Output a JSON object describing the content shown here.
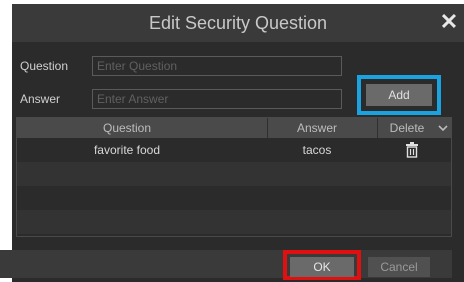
{
  "dialog": {
    "title": "Edit Security Question",
    "close_icon": "close-icon"
  },
  "form": {
    "question_label": "Question",
    "question_value": "",
    "question_placeholder": "Enter Question",
    "answer_label": "Answer",
    "answer_value": "",
    "answer_placeholder": "Enter Answer",
    "add_label": "Add"
  },
  "table": {
    "columns": [
      "Question",
      "Answer",
      "Delete"
    ],
    "rows": [
      {
        "question": "favorite food",
        "answer": "tacos",
        "delete_icon": "trash-icon"
      }
    ]
  },
  "footer": {
    "ok_label": "OK",
    "cancel_label": "Cancel"
  },
  "colors": {
    "dialog_bg": "#2b2b2b",
    "titlebar_bg": "#3a3a3a",
    "highlight_add": "#1aa3e0",
    "highlight_ok": "#e01010"
  }
}
